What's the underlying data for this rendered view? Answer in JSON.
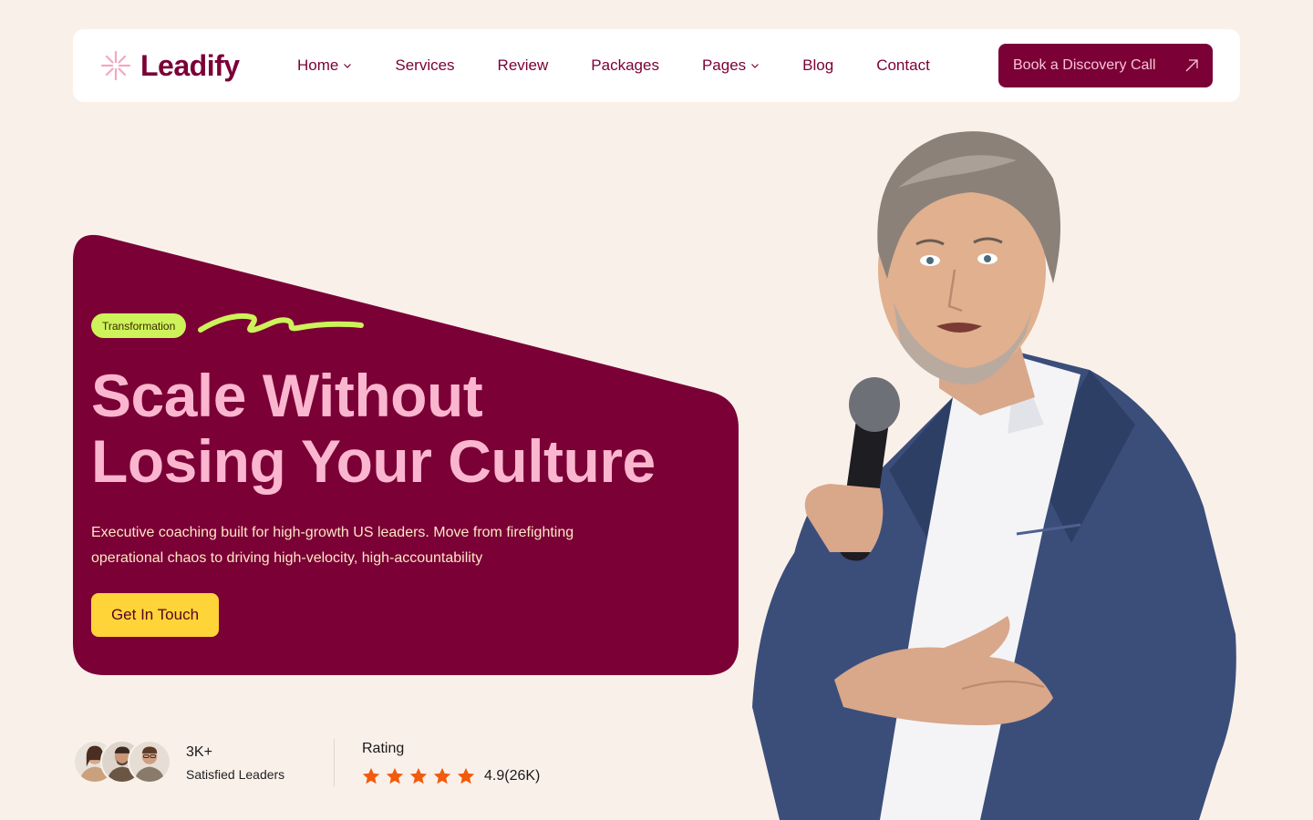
{
  "brand": {
    "name": "Leadify",
    "accent": "#7a0036",
    "pink": "#fbb6cf",
    "lime": "#cdf25a",
    "yellow": "#ffd439",
    "star_color": "#f25a0c"
  },
  "nav": {
    "items": [
      {
        "label": "Home",
        "dropdown": true
      },
      {
        "label": "Services",
        "dropdown": false
      },
      {
        "label": "Review",
        "dropdown": false
      },
      {
        "label": "Packages",
        "dropdown": false
      },
      {
        "label": "Pages",
        "dropdown": true
      },
      {
        "label": "Blog",
        "dropdown": false
      },
      {
        "label": "Contact",
        "dropdown": false
      }
    ],
    "cta_label": "Book a Discovery Call",
    "cta_icon": "arrow-up-right-icon"
  },
  "hero": {
    "tag": "Transformation",
    "headline_line1": "Scale Without",
    "headline_line2": "Losing Your Culture",
    "subtext": "Executive coaching built for high-growth US leaders. Move from firefighting operational chaos to driving high-velocity, high-accountability",
    "button_label": "Get In Touch"
  },
  "stats": {
    "leaders_count": "3K+",
    "leaders_label": "Satisfied Leaders",
    "rating_label": "Rating",
    "rating_stars": 5,
    "rating_value": "4.9(26K)"
  }
}
